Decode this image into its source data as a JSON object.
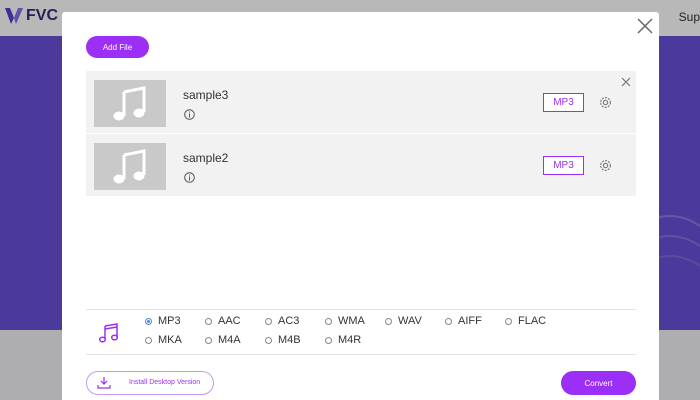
{
  "brand": {
    "name": "FVC",
    "color": "#3a2a7a"
  },
  "nav": {
    "right_text": "Sup"
  },
  "colors": {
    "accent": "#9b2ff5",
    "hero": "#6a4fd8",
    "radio_selected": "#4a86e8"
  },
  "modal": {
    "add_file_label": "Add File",
    "files": [
      {
        "name": "sample3",
        "format": "MP3"
      },
      {
        "name": "sample2",
        "format": "MP3"
      }
    ],
    "formats": [
      "MP3",
      "AAC",
      "AC3",
      "WMA",
      "WAV",
      "AIFF",
      "FLAC",
      "MKA",
      "M4A",
      "M4B",
      "M4R"
    ],
    "selected_format": "MP3",
    "install_label": "Install Desktop Version",
    "convert_label": "Convert"
  },
  "icons": {
    "close": "close-icon",
    "remove": "close-icon",
    "settings": "gear-icon",
    "info": "info-icon",
    "file": "music-note-icon",
    "audio": "music-note-icon",
    "download": "download-icon"
  }
}
